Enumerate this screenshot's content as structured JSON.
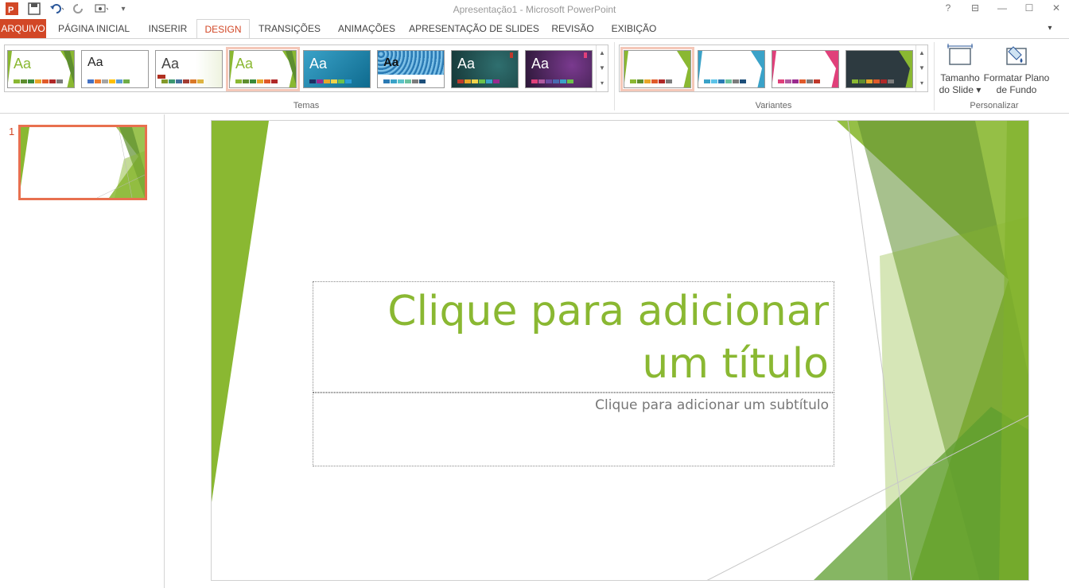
{
  "window": {
    "title": "Apresentação1 - Microsoft PowerPoint",
    "help": "?",
    "restore": "⊟",
    "minimize": "—",
    "maximize": "☐",
    "close": "✕"
  },
  "tabs": [
    {
      "label": "ARQUIVO"
    },
    {
      "label": "PÁGINA INICIAL"
    },
    {
      "label": "INSERIR"
    },
    {
      "label": "DESIGN"
    },
    {
      "label": "TRANSIÇÕES"
    },
    {
      "label": "ANIMAÇÕES"
    },
    {
      "label": "APRESENTAÇÃO DE SLIDES"
    },
    {
      "label": "REVISÃO"
    },
    {
      "label": "EXIBIÇÃO"
    }
  ],
  "ribbon": {
    "themes_label": "Temas",
    "variants_label": "Variantes",
    "customize_label": "Personalizar",
    "slide_size_label1": "Tamanho",
    "slide_size_label2": "do Slide ▾",
    "format_bg_label1": "Formatar Plano",
    "format_bg_label2": "de Fundo",
    "themes": [
      {
        "aa": "Aa",
        "color": "#8ab832"
      },
      {
        "aa": "Aa",
        "color": "#222222"
      },
      {
        "aa": "Aa",
        "color": "#444444"
      },
      {
        "aa": "Aa",
        "color": "#8ab832"
      },
      {
        "aa": "Aa",
        "color": "#ffffff"
      },
      {
        "aa": "Aa",
        "color": "#111111"
      },
      {
        "aa": "Aa",
        "color": "#ffffff"
      },
      {
        "aa": "Aa",
        "color": "#ffffff"
      }
    ]
  },
  "slides": {
    "number": "1"
  },
  "slide": {
    "title_line1": "Clique para adicionar",
    "title_line2": "um título",
    "subtitle": "Clique para adicionar um subtítulo"
  },
  "colors": {
    "accent": "#d24726",
    "theme_green": "#8ab832"
  }
}
